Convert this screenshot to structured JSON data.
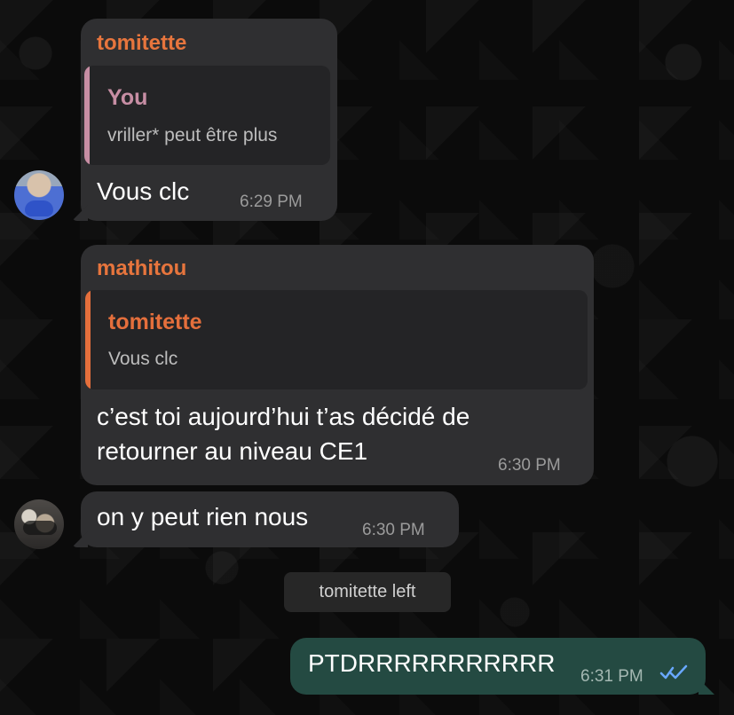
{
  "messages": [
    {
      "sender": "tomitette",
      "reply": {
        "name": "You",
        "text": "vriller* peut être plus"
      },
      "text": "Vous clc",
      "time": "6:29 PM"
    },
    {
      "sender": "mathitou",
      "reply": {
        "name": "tomitette",
        "text": "Vous clc"
      },
      "text_lines": [
        "c’est toi aujourd’hui t’as décidé de",
        "retourner au niveau CE1"
      ],
      "time": "6:30 PM"
    },
    {
      "text": "on y peut rien nous",
      "time": "6:30 PM"
    }
  ],
  "system_notice": "tomitette left",
  "outgoing": {
    "text": "PTDRRRRRRRRRRR",
    "time": "6:31 PM"
  },
  "colors": {
    "sender": "#e7753d",
    "reply_you": "#c78ea4",
    "reply_tomitette": "#e56f3c",
    "outgoing_bubble": "#244a42"
  },
  "icons": {
    "read": "double-check-icon"
  }
}
